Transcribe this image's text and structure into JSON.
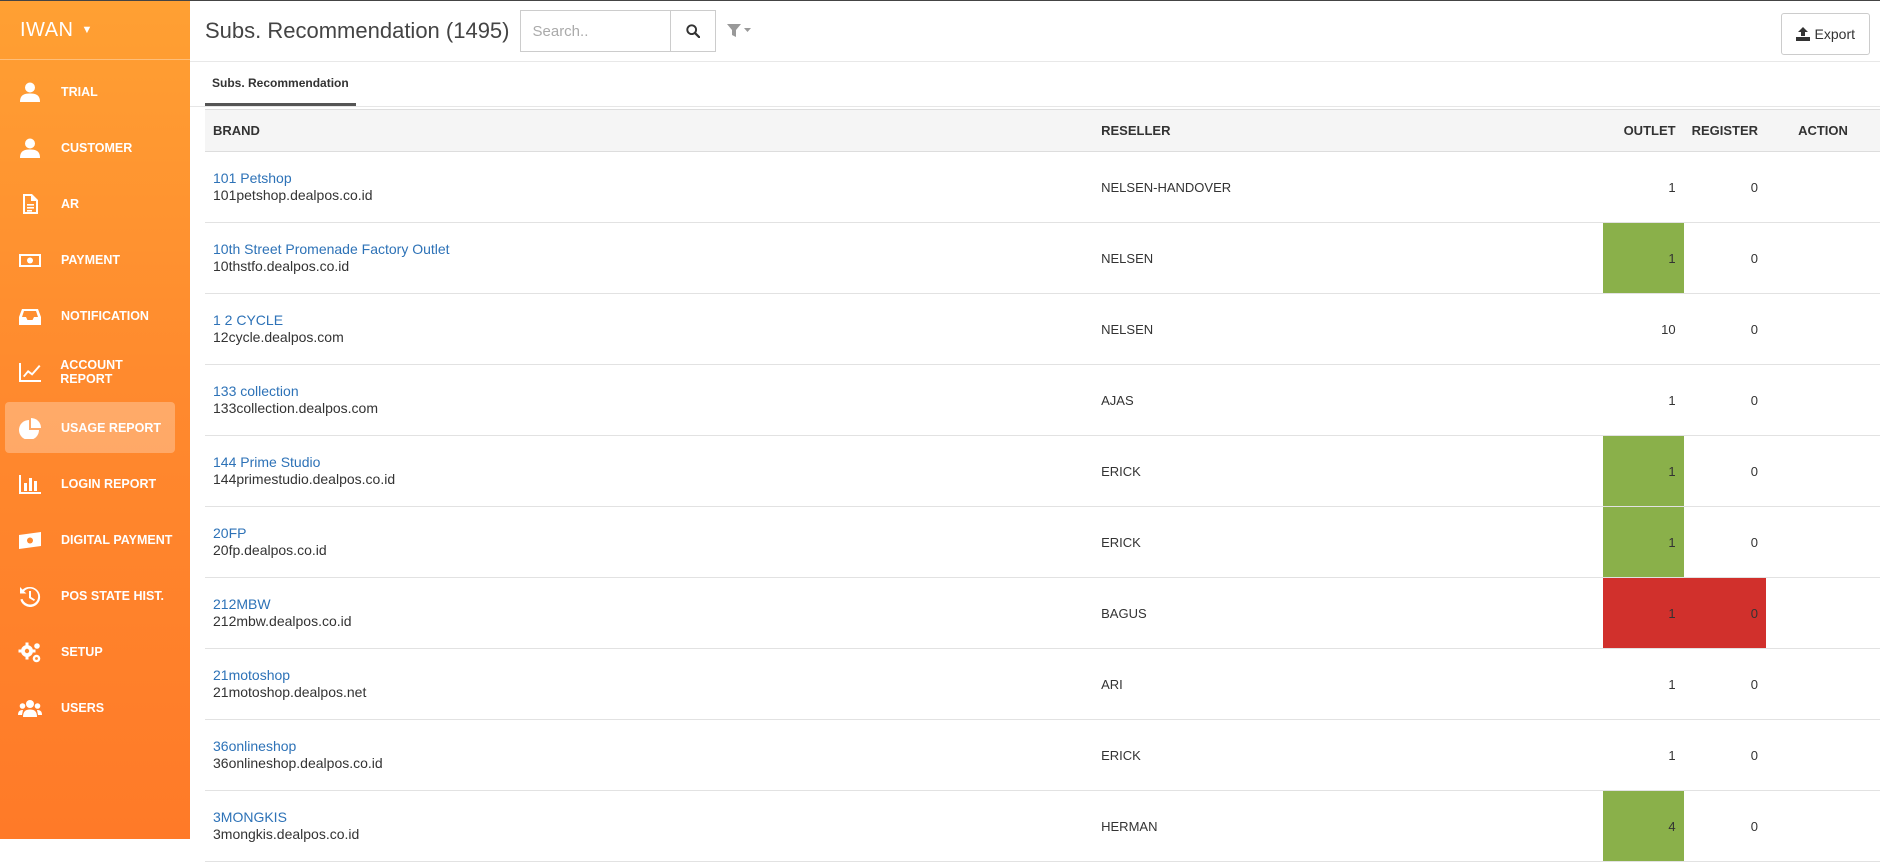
{
  "sidebar": {
    "user": "IWAN",
    "items": [
      {
        "label": "TRIAL",
        "icon": "user-icon",
        "active": false
      },
      {
        "label": "CUSTOMER",
        "icon": "user-icon",
        "active": false
      },
      {
        "label": "AR",
        "icon": "document-icon",
        "active": false
      },
      {
        "label": "PAYMENT",
        "icon": "money-icon",
        "active": false
      },
      {
        "label": "NOTIFICATION",
        "icon": "inbox-icon",
        "active": false
      },
      {
        "label": "ACCOUNT REPORT",
        "icon": "line-chart-icon",
        "active": false
      },
      {
        "label": "USAGE REPORT",
        "icon": "pie-chart-icon",
        "active": true
      },
      {
        "label": "LOGIN REPORT",
        "icon": "bar-chart-icon",
        "active": false
      },
      {
        "label": "DIGITAL PAYMENT",
        "icon": "cash-icon",
        "active": false
      },
      {
        "label": "POS STATE HIST.",
        "icon": "history-icon",
        "active": false
      },
      {
        "label": "SETUP",
        "icon": "gears-icon",
        "active": false
      },
      {
        "label": "USERS",
        "icon": "users-icon",
        "active": false
      }
    ]
  },
  "header": {
    "title": "Subs. Recommendation (1495)",
    "search_placeholder": "Search..",
    "export_label": "Export"
  },
  "tabs": [
    {
      "label": "Subs. Recommendation",
      "active": true
    }
  ],
  "table": {
    "columns": {
      "brand": "BRAND",
      "reseller": "RESELLER",
      "outlet": "OUTLET",
      "register": "REGISTER",
      "action": "ACTION"
    },
    "rows": [
      {
        "brand": "101 Petshop",
        "domain": "101petshop.dealpos.co.id",
        "reseller": "NELSEN-HANDOVER",
        "outlet": "1",
        "register": "0",
        "outlet_status": "",
        "register_status": ""
      },
      {
        "brand": "10th Street Promenade Factory Outlet",
        "domain": "10thstfo.dealpos.co.id",
        "reseller": "NELSEN",
        "outlet": "1",
        "register": "0",
        "outlet_status": "green",
        "register_status": ""
      },
      {
        "brand": "1 2 CYCLE",
        "domain": "12cycle.dealpos.com",
        "reseller": "NELSEN",
        "outlet": "10",
        "register": "0",
        "outlet_status": "",
        "register_status": ""
      },
      {
        "brand": "133 collection",
        "domain": "133collection.dealpos.com",
        "reseller": "AJAS",
        "outlet": "1",
        "register": "0",
        "outlet_status": "",
        "register_status": ""
      },
      {
        "brand": "144 Prime Studio",
        "domain": "144primestudio.dealpos.co.id",
        "reseller": "ERICK",
        "outlet": "1",
        "register": "0",
        "outlet_status": "green",
        "register_status": ""
      },
      {
        "brand": "20FP",
        "domain": "20fp.dealpos.co.id",
        "reseller": "ERICK",
        "outlet": "1",
        "register": "0",
        "outlet_status": "green",
        "register_status": ""
      },
      {
        "brand": "212MBW",
        "domain": "212mbw.dealpos.co.id",
        "reseller": "BAGUS",
        "outlet": "1",
        "register": "0",
        "outlet_status": "red",
        "register_status": "red"
      },
      {
        "brand": "21motoshop",
        "domain": "21motoshop.dealpos.net",
        "reseller": "ARI",
        "outlet": "1",
        "register": "0",
        "outlet_status": "",
        "register_status": ""
      },
      {
        "brand": "36onlineshop",
        "domain": "36onlineshop.dealpos.co.id",
        "reseller": "ERICK",
        "outlet": "1",
        "register": "0",
        "outlet_status": "",
        "register_status": ""
      },
      {
        "brand": "3MONGKIS",
        "domain": "3mongkis.dealpos.co.id",
        "reseller": "HERMAN",
        "outlet": "4",
        "register": "0",
        "outlet_status": "green",
        "register_status": ""
      }
    ]
  },
  "colors": {
    "sidebar_top": "#ffa033",
    "sidebar_bottom": "#ff7a28",
    "link": "#2d72b7",
    "status_green": "#8ab04a",
    "status_red": "#d1302c"
  }
}
